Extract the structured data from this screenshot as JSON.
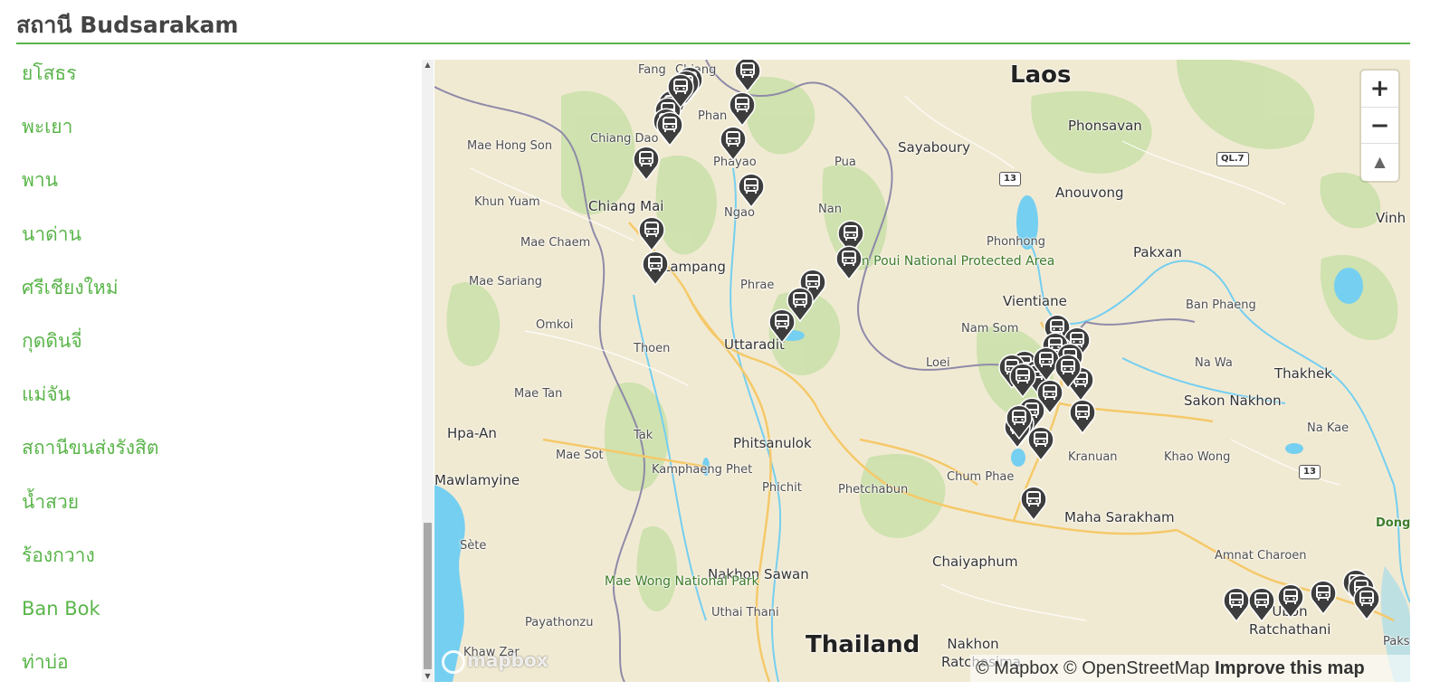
{
  "page": {
    "title": "สถานี Budsarakam"
  },
  "stations": [
    "ยโสธร",
    "พะเยา",
    "พาน",
    "นาด่าน",
    "ศรีเชียงใหม่",
    "กุดดินจี่",
    "แม่จัน",
    "สถานีขนส่งรังสิต",
    "น้ำสวย",
    "ร้องกวาง",
    "Ban Bok",
    "ท่าบ่อ"
  ],
  "map": {
    "country_labels": [
      "Laos",
      "Thailand"
    ],
    "places": [
      "Fang",
      "Chiang",
      "Phan",
      "Mae Hong Son",
      "Chiang Dao",
      "Phayao",
      "Pua",
      "Sayaboury",
      "Phonsavan",
      "Khun Yuam",
      "Chiang Mai",
      "Ngao",
      "Nan",
      "Anouvong",
      "Vinh",
      "Mae Chaem",
      "Lampang",
      "Phonhong",
      "Pakxan",
      "Mae Sariang",
      "Phrae",
      "Vientiane",
      "Ban Phaeng",
      "Omkoi",
      "Nam Som",
      "Uttaradit",
      "Thoen",
      "Loei",
      "Na Wa",
      "Thakhek",
      "Mae Tan",
      "Sakon Nakhon",
      "Hpa-An",
      "Tak",
      "Na Kae",
      "Phitsanulok",
      "Mae Sot",
      "Kranuan",
      "Mawlamyine",
      "Kamphaeng Phet",
      "Phichit",
      "Phetchabun",
      "Chum Phae",
      "Khao Wong",
      "Maha Sarakham",
      "Sète",
      "Chaiyaphum",
      "Amnat Charoen",
      "Nakhon Sawan",
      "Ubon Ratchathani",
      "Uthai Thani",
      "Payathonzu",
      "Khaw Zar",
      "Nakhon Ratchasima",
      "Dong P",
      "Paks"
    ],
    "parks": [
      "Nam Poui National Protected Area",
      "Mae Wong National Park"
    ],
    "road_shields": [
      "13",
      "QL.7",
      "13"
    ],
    "marker_icon": "bus-marker-icon",
    "marker_count": 46
  },
  "controls": {
    "zoom_in": "+",
    "zoom_out": "−",
    "compass": "▲"
  },
  "attribution": {
    "logo": "mapbox",
    "mapbox": "© Mapbox",
    "osm": "© OpenStreetMap",
    "improve": "Improve this map"
  },
  "colors": {
    "accent": "#5ab54a",
    "marker": "#3d3d3d",
    "water": "#75cff0",
    "land": "#f1ead3",
    "forest": "#c9e0a8"
  }
}
